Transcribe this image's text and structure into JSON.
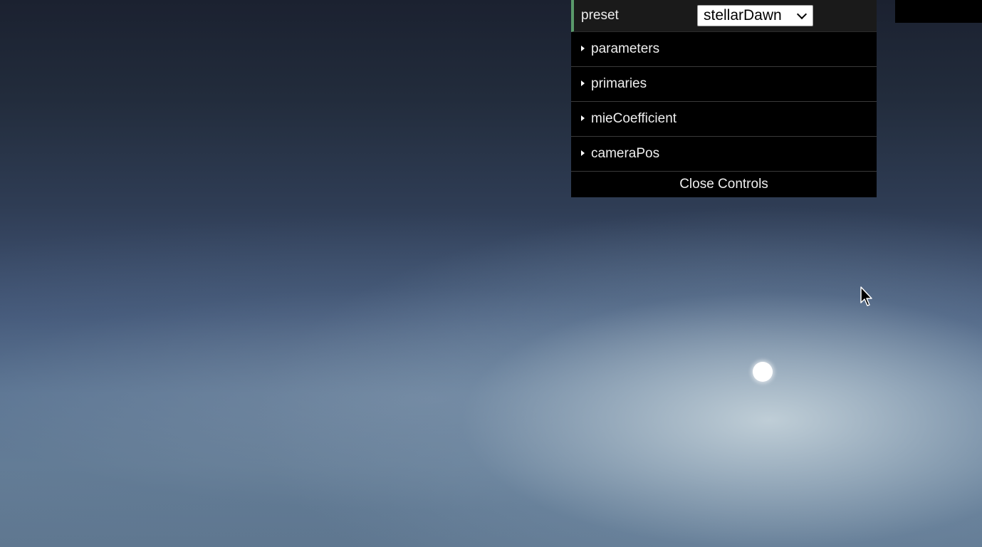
{
  "gui": {
    "preset": {
      "label": "preset",
      "selected": "stellarDawn"
    },
    "folders": [
      {
        "label": "parameters"
      },
      {
        "label": "primaries"
      },
      {
        "label": "mieCoefficient"
      },
      {
        "label": "cameraPos"
      }
    ],
    "close_label": "Close Controls"
  },
  "icons": {
    "folder_toggle": "caret-right-icon",
    "select_toggle": "chevron-down-icon",
    "pointer": "mouse-cursor-icon"
  },
  "colors": {
    "panel_bg": "#000000",
    "preset_row_bg": "#1a1a1a",
    "preset_accent": "#5a9a6a",
    "sun": "#ffffff"
  }
}
